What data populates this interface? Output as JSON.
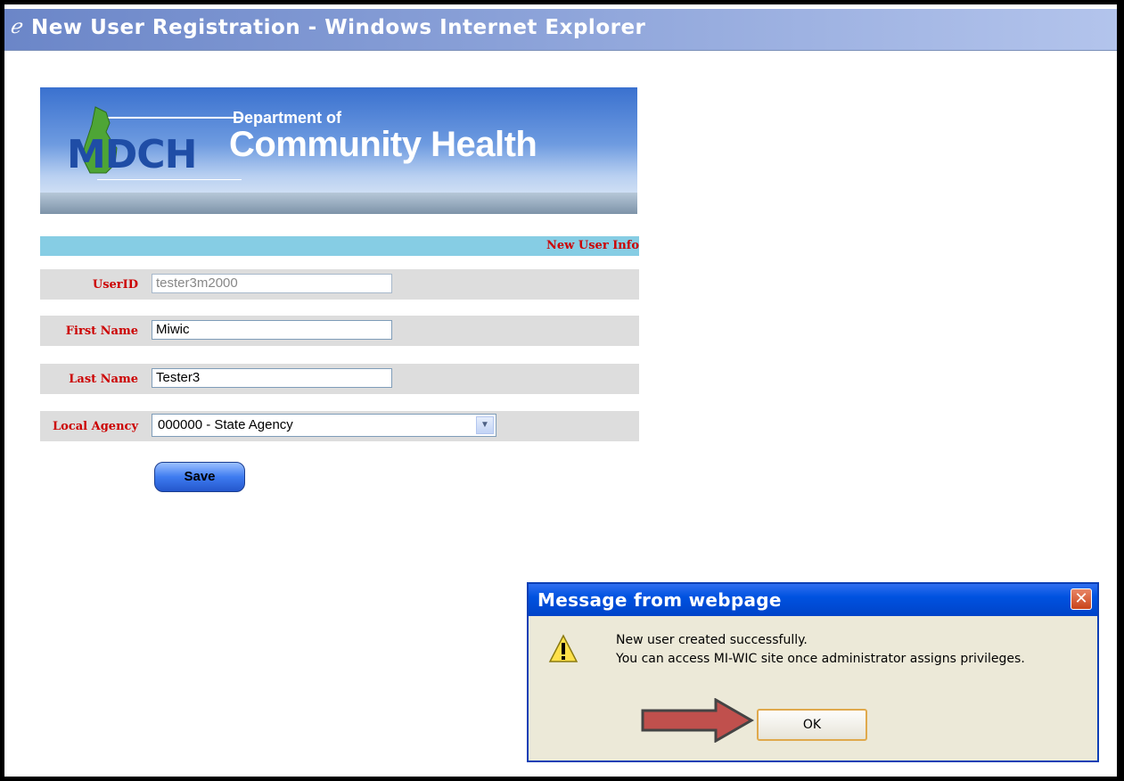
{
  "window": {
    "title": "New User Registration - Windows Internet Explorer"
  },
  "banner": {
    "logo_text": "MDCH",
    "dept_line": "Department of",
    "title_line": "Community Health"
  },
  "section": {
    "header": "New User Info"
  },
  "form": {
    "userid_label": "UserID",
    "userid_value": "tester3m2000",
    "first_name_label": "First Name",
    "first_name_value": "Miwic",
    "last_name_label": "Last Name",
    "last_name_value": "Tester3",
    "agency_label": "Local Agency",
    "agency_value": "000000 - State Agency",
    "save_label": "Save"
  },
  "dialog": {
    "title": "Message from webpage",
    "line1": "New user created successfully.",
    "line2": "You can access MI-WIC site once administrator assigns privileges.",
    "ok_label": "OK",
    "close_glyph": "✕"
  },
  "icons": {
    "browser": "ie-icon",
    "warning": "warning-icon",
    "close": "close-icon",
    "dropdown": "chevron-down-icon"
  },
  "colors": {
    "label_red": "#cc0000",
    "section_bar": "#86cde4",
    "dialog_title": "#0052e0"
  }
}
